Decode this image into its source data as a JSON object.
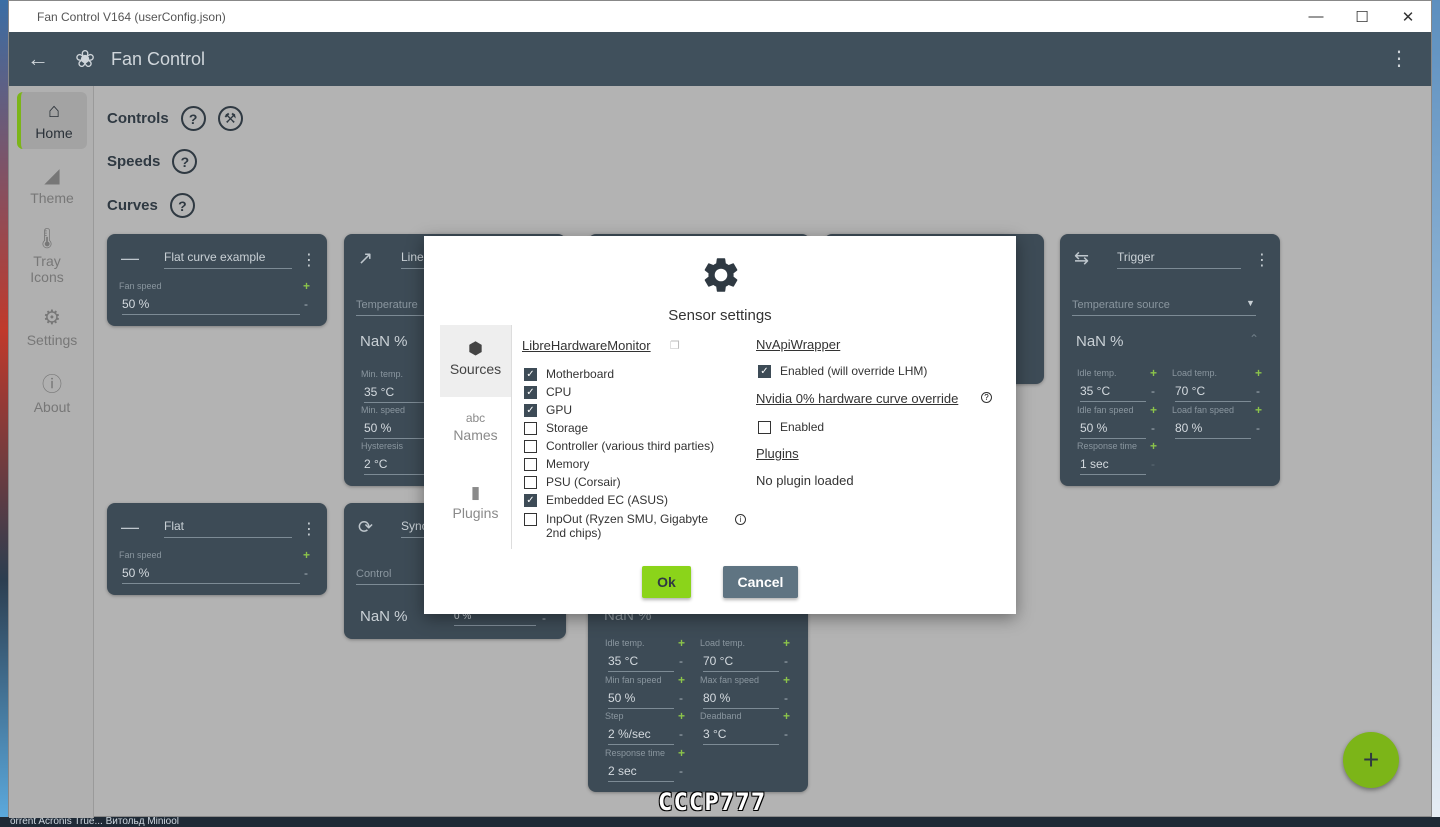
{
  "window": {
    "title": "Fan Control V164 (userConfig.json)"
  },
  "appbar": {
    "title": "Fan Control"
  },
  "nav": [
    {
      "label": "Home"
    },
    {
      "label": "Theme"
    },
    {
      "label": "Tray Icons"
    },
    {
      "label": "Settings"
    },
    {
      "label": "About"
    }
  ],
  "sections": {
    "controls": "Controls",
    "speeds": "Speeds",
    "curves": "Curves"
  },
  "cards": {
    "flat_example": {
      "name": "Flat curve example",
      "label": "Fan speed",
      "value": "50 %"
    },
    "flat": {
      "name": "Flat",
      "label": "Fan speed",
      "value": "50 %"
    },
    "linear": {
      "name": "Linea",
      "source": "Temperature",
      "big": "NaN %",
      "min_temp_label": "Min. temp.",
      "min_temp": "35 °C",
      "min_speed_label": "Min. speed",
      "min_speed": "50 %",
      "hyst_label": "Hysteresis",
      "hyst": "2 °C"
    },
    "sync": {
      "name": "Sync",
      "source": "Control",
      "big": "NaN %",
      "value": "0 %"
    },
    "trigger": {
      "name": "Trigger",
      "source": "Temperature source",
      "big": "NaN %",
      "idle_temp_label": "Idle temp.",
      "idle_temp": "35 °C",
      "load_temp_label": "Load temp.",
      "load_temp": "70 °C",
      "idle_fan_label": "Idle fan speed",
      "idle_fan": "50 %",
      "load_fan_label": "Load fan speed",
      "load_fan": "80 %",
      "resp_label": "Response time",
      "resp": "1 sec"
    },
    "bottom": {
      "idle_temp_label": "Idle temp.",
      "idle_temp": "35 °C",
      "load_temp_label": "Load temp.",
      "load_temp": "70 °C",
      "min_fan_label": "Min fan speed",
      "min_fan": "50 %",
      "max_fan_label": "Max fan speed",
      "max_fan": "80 %",
      "step_label": "Step",
      "step": "2 %/sec",
      "deadband_label": "Deadband",
      "deadband": "3 °C",
      "resp_label": "Response time",
      "resp": "2 sec",
      "big": "NaN %"
    }
  },
  "dialog": {
    "title": "Sensor settings",
    "tabs": [
      {
        "label": "Sources"
      },
      {
        "label": "Names"
      },
      {
        "label": "Plugins"
      }
    ],
    "lhm": {
      "heading": "LibreHardwareMonitor",
      "items": [
        {
          "label": "Motherboard",
          "checked": true
        },
        {
          "label": "CPU",
          "checked": true
        },
        {
          "label": "GPU",
          "checked": true
        },
        {
          "label": "Storage",
          "checked": false
        },
        {
          "label": "Controller (various third parties)",
          "checked": false
        },
        {
          "label": "Memory",
          "checked": false
        },
        {
          "label": "PSU (Corsair)",
          "checked": false
        },
        {
          "label": "Embedded EC (ASUS)",
          "checked": true
        },
        {
          "label": "InpOut (Ryzen SMU, Gigabyte 2nd chips)",
          "checked": false
        }
      ]
    },
    "nvapi": {
      "heading": "NvApiWrapper",
      "enabled_label": "Enabled (will override LHM)"
    },
    "nvidia_override": {
      "heading": "Nvidia 0% hardware curve override",
      "enabled_label": "Enabled"
    },
    "plugins": {
      "heading": "Plugins",
      "status": "No plugin loaded"
    },
    "ok_label": "Ok",
    "cancel_label": "Cancel"
  },
  "taskbar": {
    "text": "orrent    Acronis True...    Витольд    Miniool"
  },
  "watermark": "CCCP777"
}
